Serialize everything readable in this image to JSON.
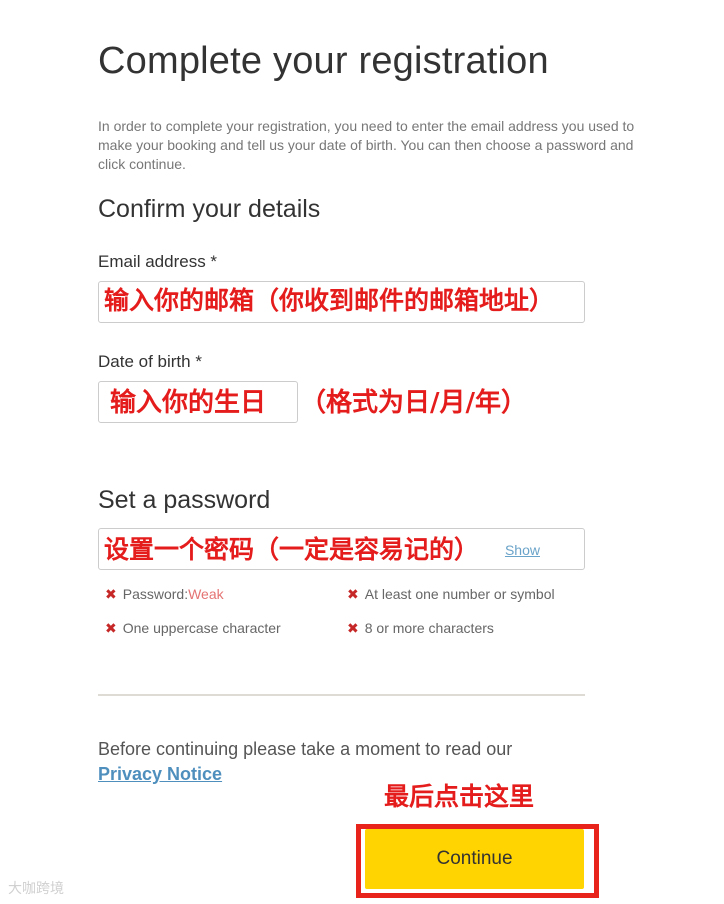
{
  "page": {
    "title": "Complete your registration",
    "intro": "In order to complete your registration, you need to enter the email address you used to make your booking and tell us your date of birth. You can then choose a password and click continue."
  },
  "details": {
    "heading": "Confirm your details",
    "email_label": "Email address *",
    "email_annotation": "输入你的邮箱（你收到邮件的邮箱地址）",
    "dob_label": "Date of birth *",
    "dob_annotation": "输入你的生日",
    "dob_annotation_extra": "（格式为日/月/年）"
  },
  "password": {
    "heading": "Set a password",
    "annotation": "设置一个密码（一定是容易记的）",
    "show_label": "Show",
    "rules": {
      "strength_label": "Password:",
      "strength_value": "Weak",
      "number_symbol": "At least one number or symbol",
      "uppercase": "One uppercase character",
      "length": "8 or more characters"
    },
    "rule_icon": "✖"
  },
  "footer": {
    "notice": "Before continuing please take a moment to read our",
    "privacy_link": "Privacy Notice",
    "click_annotation": "最后点击这里",
    "continue_label": "Continue"
  },
  "watermark": "大咖跨境",
  "colors": {
    "annotation_red": "#e51c1c",
    "button_yellow": "#ffd400",
    "link_blue": "#4e8fbd"
  }
}
